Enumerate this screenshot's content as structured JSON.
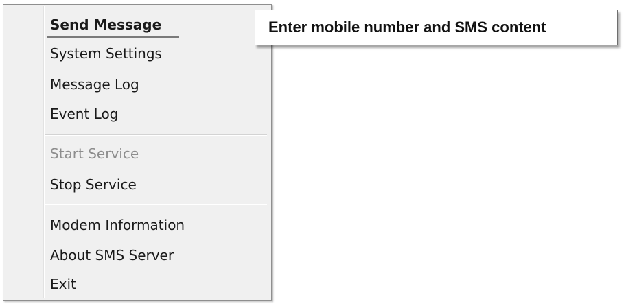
{
  "menu": {
    "items": [
      {
        "label": "Send Message",
        "bold": true,
        "enabled": true
      },
      {
        "label": "System Settings",
        "enabled": true
      },
      {
        "label": "Message Log",
        "enabled": true
      },
      {
        "label": "Event Log",
        "enabled": true
      },
      {
        "label": "Start Service",
        "enabled": false
      },
      {
        "label": "Stop Service",
        "enabled": true
      },
      {
        "label": "Modem Information",
        "enabled": true
      },
      {
        "label": "About SMS Server",
        "enabled": true
      },
      {
        "label": "Exit",
        "enabled": true
      }
    ]
  },
  "tooltip": {
    "text": "Enter mobile number and SMS content"
  }
}
